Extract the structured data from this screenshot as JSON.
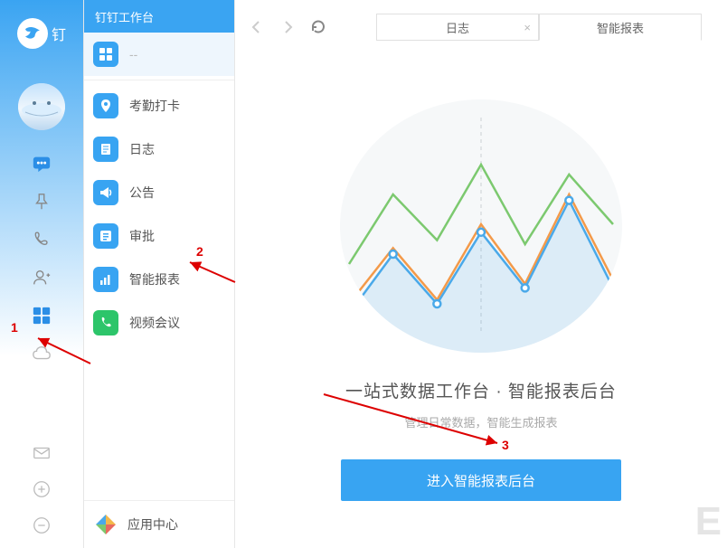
{
  "brand": {
    "name_partial": "钉"
  },
  "panel_title": "钉钉工作台",
  "panel_items": [
    {
      "label": "考勤打卡",
      "icon": "pin-icon",
      "color": "#38a4f2"
    },
    {
      "label": "日志",
      "icon": "note-icon",
      "color": "#38a4f2"
    },
    {
      "label": "公告",
      "icon": "bullhorn-icon",
      "color": "#38a4f2"
    },
    {
      "label": "审批",
      "icon": "checklist-icon",
      "color": "#38a4f2"
    },
    {
      "label": "智能报表",
      "icon": "chart-icon",
      "color": "#38a4f2"
    },
    {
      "label": "视频会议",
      "icon": "phone-icon",
      "color": "#2dc56a"
    }
  ],
  "app_center_label": "应用中心",
  "tabs": [
    {
      "label": "日志"
    },
    {
      "label": "智能报表"
    }
  ],
  "hero": {
    "title": "一站式数据工作台 · 智能报表后台",
    "subtitle": "管理日常数据，智能生成报表",
    "button_label": "进入智能报表后台"
  },
  "annotations": {
    "a1": "1",
    "a2": "2",
    "a3": "3"
  },
  "watermark_letter": "E",
  "chart_data": {
    "type": "line",
    "title": "",
    "xlabel": "",
    "ylabel": "",
    "x": [
      0,
      1,
      2,
      3,
      4,
      5,
      6
    ],
    "series": [
      {
        "name": "green",
        "color": "#7cc96f",
        "values": [
          40,
          75,
          52,
          90,
          50,
          85,
          60
        ]
      },
      {
        "name": "orange",
        "color": "#f39a4a",
        "values": [
          20,
          48,
          22,
          60,
          30,
          75,
          32
        ]
      },
      {
        "name": "blue",
        "color": "#4aa9e9",
        "values": [
          15,
          45,
          20,
          56,
          28,
          72,
          28
        ],
        "area": true,
        "markers": true
      }
    ],
    "ylim": [
      0,
      100
    ],
    "grid_vertical_dashed_at_x": 3
  }
}
